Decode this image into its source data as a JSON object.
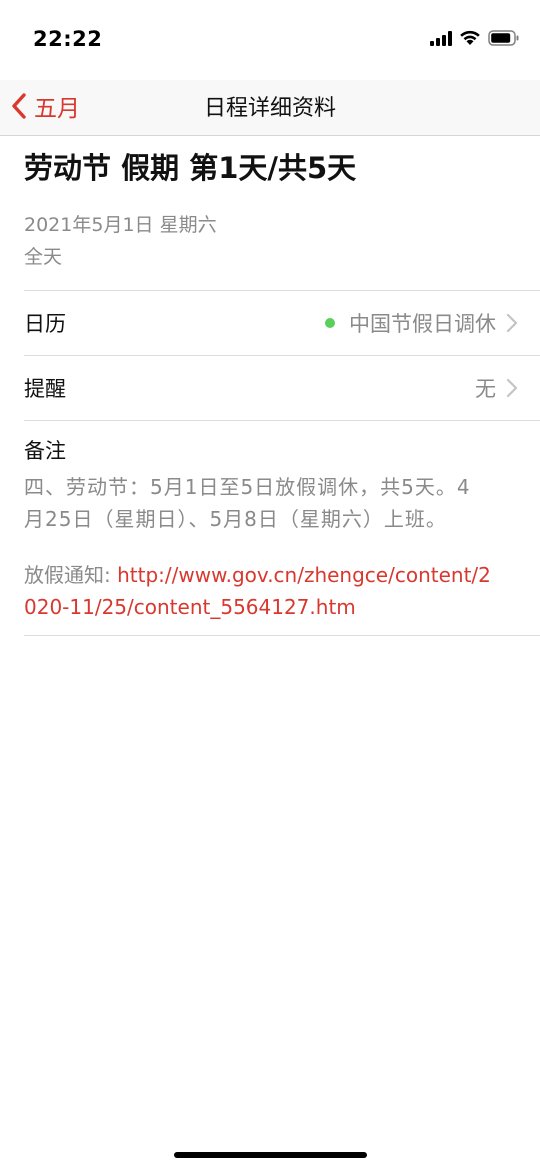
{
  "status_bar": {
    "time": "22:22"
  },
  "nav": {
    "back_label": "五月",
    "title": "日程详细资料"
  },
  "event": {
    "title": "劳动节 假期 第1天/共5天",
    "date": "2021年5月1日 星期六",
    "all_day": "全天"
  },
  "calendar_row": {
    "label": "日历",
    "value": "中国节假日调休",
    "dot_color": "#5ad05b"
  },
  "alert_row": {
    "label": "提醒",
    "value": "无"
  },
  "notes": {
    "label": "备注",
    "text": "四、劳动节：5月1日至5日放假调休，共5天。4月25日（星期日）、5月8日（星期六）上班。",
    "link_prefix": "放假通知: ",
    "link_text": "http://www.gov.cn/zhengce/content/2020-11/25/content_5564127.htm"
  },
  "colors": {
    "accent": "#d9382f",
    "secondary_text": "#8a8a8a"
  },
  "icons": {
    "back": "chevron-left-icon",
    "disclosure": "chevron-right-icon",
    "signal": "cellular-signal-icon",
    "wifi": "wifi-icon",
    "battery": "battery-icon"
  }
}
